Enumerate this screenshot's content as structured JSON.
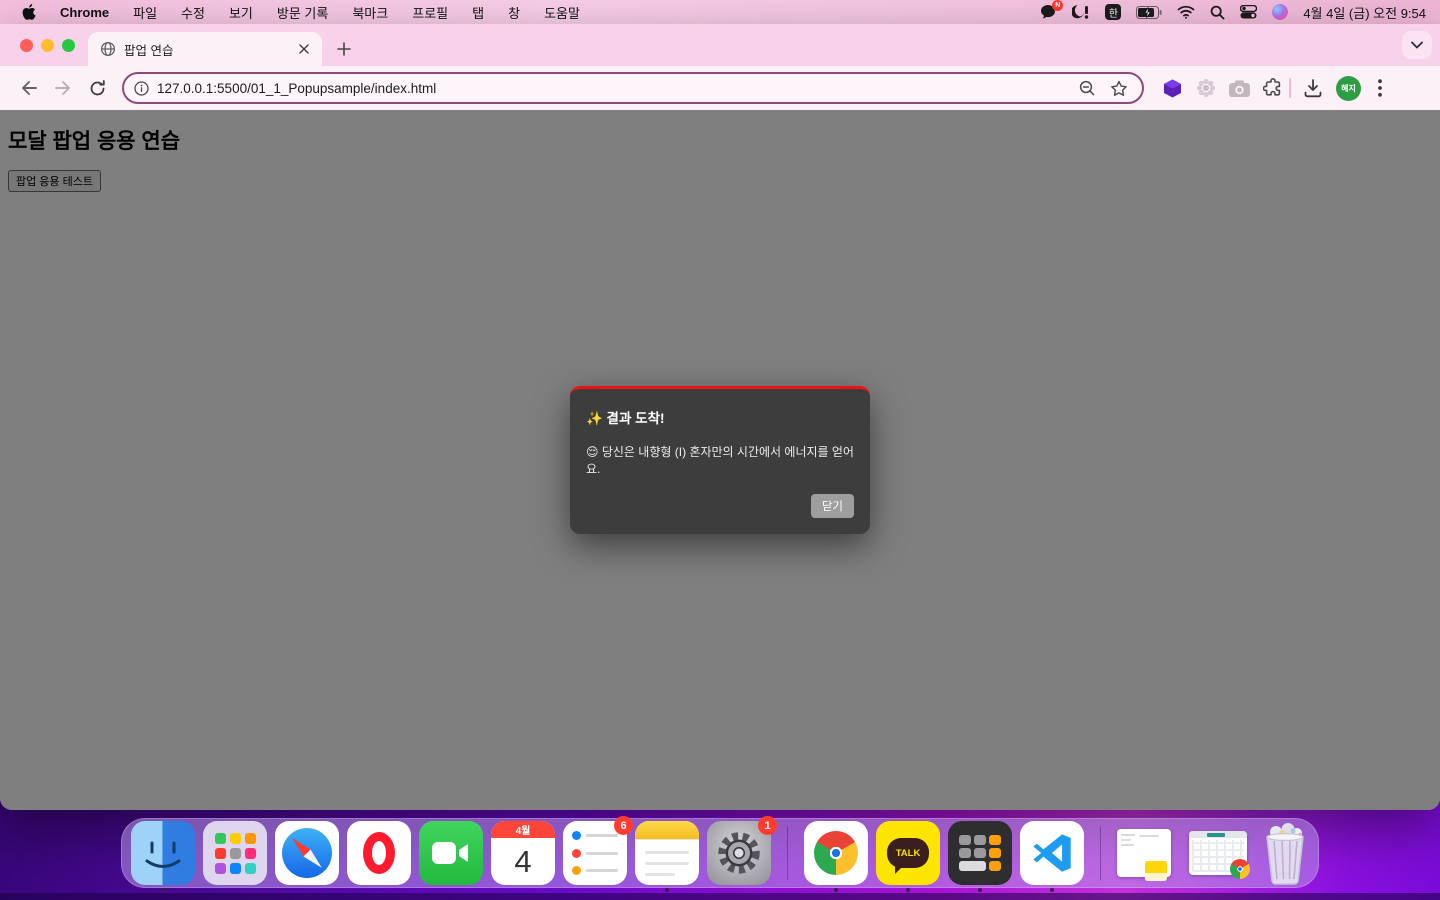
{
  "menubar": {
    "app_name": "Chrome",
    "menus": [
      "파일",
      "수정",
      "보기",
      "방문 기록",
      "북마크",
      "프로필",
      "탭",
      "창",
      "도움말"
    ],
    "chat_badge": "N",
    "input_source": "한",
    "clock": "4월 4일 (금) 오전 9:54"
  },
  "browser": {
    "tab_title": "팝업 연습",
    "url": "127.0.0.1:5500/01_1_Popupsample/index.html",
    "profile_initials": "혜지"
  },
  "page": {
    "heading": "모달 팝업 응용 연습",
    "open_button_label": "팝업 응용 테스트"
  },
  "modal": {
    "title": "✨ 결과 도착!",
    "message": "😌 당신은 내향형 (I) 혼자만의 시간에서 에너지를 얻어요.",
    "close_label": "닫기"
  },
  "dock": {
    "calendar_month": "4월",
    "calendar_day": "4",
    "kakao_label": "TALK",
    "reminders_badge": "6",
    "settings_badge": "1"
  },
  "colors": {
    "modal_accent": "#f01212",
    "menubar_pink": "#f6c6e2",
    "toolbar_pink": "#fdf1f8",
    "omnibox_border": "#8d4a78",
    "overlay": "rgba(0,0,0,0.5)",
    "profile_green": "#2e9e44",
    "dock_background": "rgba(186,152,235,0.55)"
  }
}
